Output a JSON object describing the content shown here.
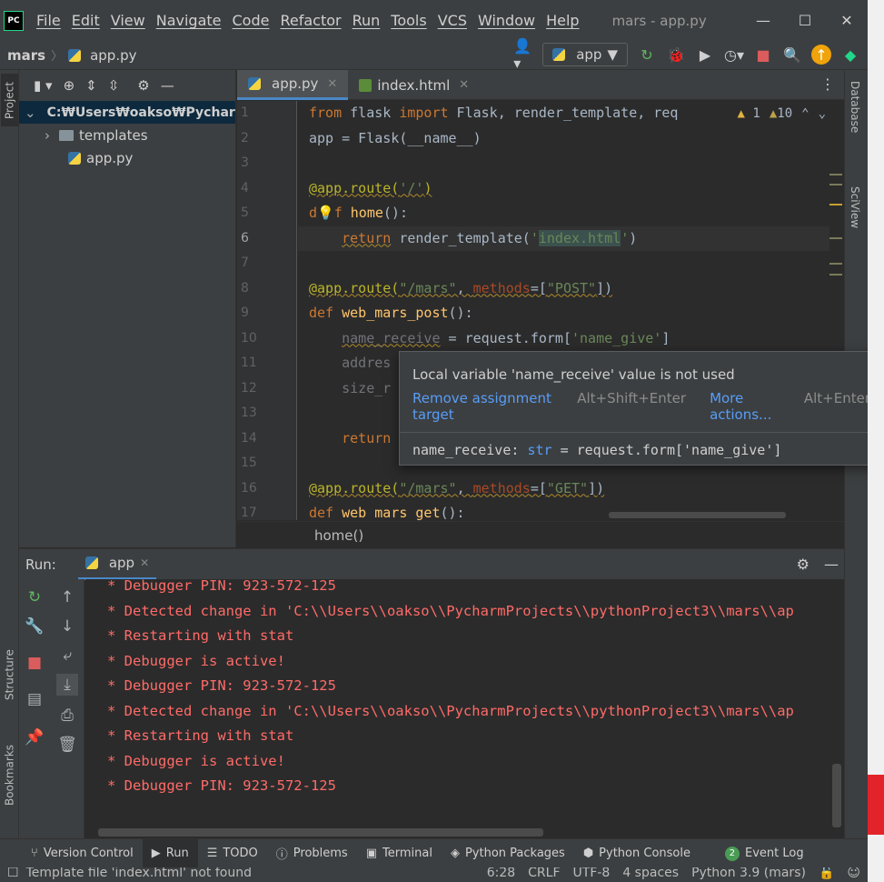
{
  "window": {
    "title": "mars - app.py",
    "logo": "PC",
    "menu": [
      "File",
      "Edit",
      "View",
      "Navigate",
      "Code",
      "Refactor",
      "Run",
      "Tools",
      "VCS",
      "Window",
      "Help"
    ],
    "minimize": "—",
    "maximize": "☐",
    "close": "✕"
  },
  "navbar": {
    "project": "mars",
    "file": "app.py",
    "run_config": "app"
  },
  "project_panel": {
    "tab_label": "Project",
    "root": "C:₩Users₩oakso₩Pycharm",
    "items": [
      {
        "label": "templates",
        "type": "folder"
      },
      {
        "label": "app.py",
        "type": "python"
      }
    ]
  },
  "editor": {
    "tabs": [
      {
        "label": "app.py",
        "active": true
      },
      {
        "label": "index.html",
        "active": false
      }
    ],
    "inspections": {
      "errors": "1",
      "warnings": "10"
    },
    "line_numbers": [
      "1",
      "2",
      "3",
      "4",
      "5",
      "6",
      "7",
      "8",
      "9",
      "10",
      "11",
      "12",
      "13",
      "14",
      "15",
      "16",
      "17"
    ],
    "breadcrumb": "home()"
  },
  "popup": {
    "message": "Local variable 'name_receive' value is not used",
    "action1": "Remove assignment target",
    "action1_key": "Alt+Shift+Enter",
    "action2": "More actions...",
    "action2_key": "Alt+Enter",
    "signature_name": "name_receive",
    "signature_type": "str",
    "signature_value": "= request.form['name_give']"
  },
  "run_panel": {
    "label": "Run:",
    "tab": "app",
    "lines": [
      "* Debugger PIN: 923-572-125",
      "* Detected change in 'C:\\\\Users\\\\oakso\\\\PycharmProjects\\\\pythonProject3\\\\mars\\\\ap",
      "* Restarting with stat",
      "* Debugger is active!",
      "* Debugger PIN: 923-572-125",
      "* Detected change in 'C:\\\\Users\\\\oakso\\\\PycharmProjects\\\\pythonProject3\\\\mars\\\\ap",
      "* Restarting with stat",
      "* Debugger is active!",
      "* Debugger PIN: 923-572-125"
    ]
  },
  "side_tabs": {
    "structure": "Structure",
    "bookmarks": "Bookmarks",
    "database": "Database",
    "sciview": "SciView"
  },
  "bottom_tools": {
    "version_control": "Version Control",
    "run": "Run",
    "todo": "TODO",
    "problems": "Problems",
    "terminal": "Terminal",
    "python_packages": "Python Packages",
    "python_console": "Python Console",
    "event_log": "Event Log",
    "event_count": "2"
  },
  "status": {
    "message": "Template file 'index.html' not found",
    "position": "6:28",
    "line_sep": "CRLF",
    "encoding": "UTF-8",
    "indent": "4 spaces",
    "interpreter": "Python 3.9 (mars)"
  },
  "colors": {
    "accent": "#4a88c7",
    "console_text": "#ff6b68",
    "keyword": "#cc7832",
    "string": "#6a8759"
  }
}
